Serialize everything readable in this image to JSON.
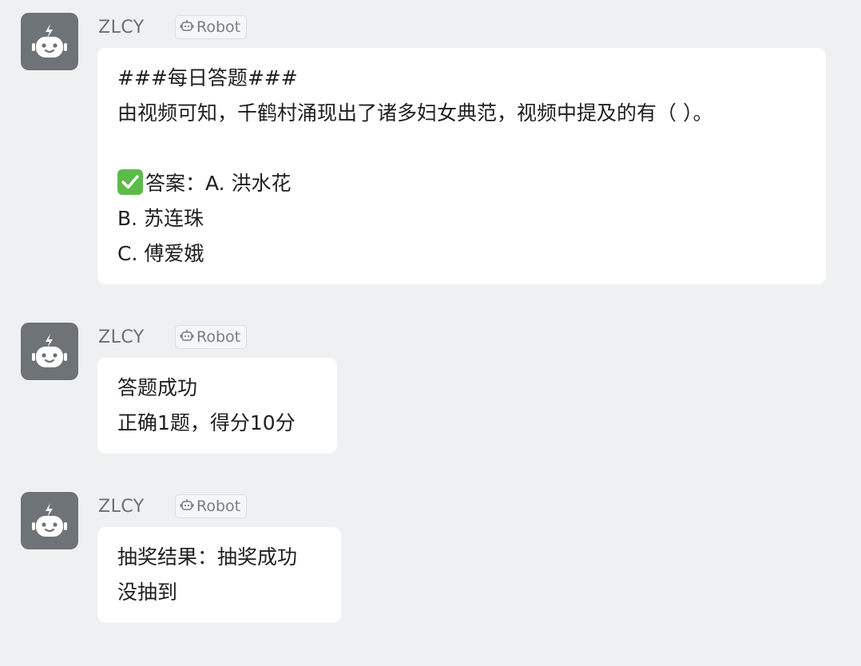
{
  "messages": [
    {
      "sender": "ZLCY",
      "badge": "Robot",
      "lines": [
        "###每日答题###",
        "由视频可知，千鹤村涌现出了诸多妇女典范，视频中提及的有（ ）。",
        "",
        "答案：A. 洪水花",
        "B. 苏连珠",
        "C. 傅爱娥"
      ]
    },
    {
      "sender": "ZLCY",
      "badge": "Robot",
      "lines": [
        "答题成功",
        "正确1题，得分10分"
      ]
    },
    {
      "sender": "ZLCY",
      "badge": "Robot",
      "lines": [
        "抽奖结果：抽奖成功",
        "没抽到"
      ]
    }
  ],
  "icons": {
    "avatar": "robot-avatar-icon",
    "badge": "robot-icon",
    "answer_marker": "check-mark-icon"
  },
  "colors": {
    "background": "#eff0f2",
    "bubble": "#ffffff",
    "avatar": "#6e7378",
    "check": "#5dbb4a"
  }
}
